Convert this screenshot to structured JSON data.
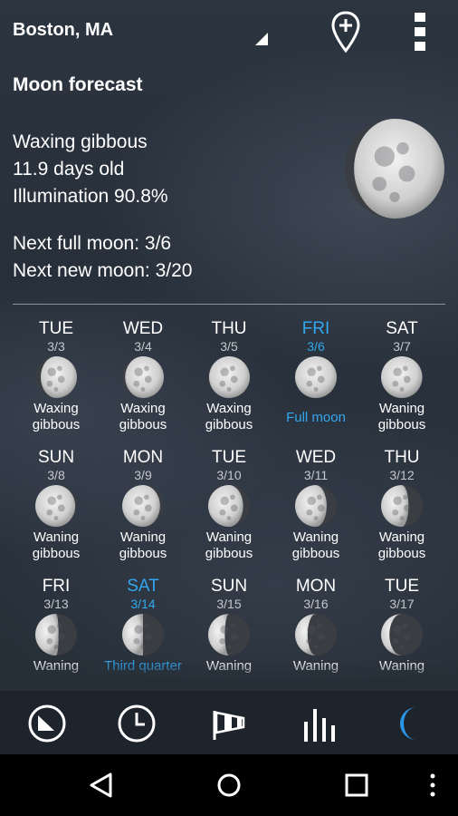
{
  "header": {
    "location": "Boston, MA",
    "icons": [
      "dropdown-icon",
      "add-location-pin-icon",
      "more-vert-icon"
    ]
  },
  "moon": {
    "title": "Moon forecast",
    "phase": "Waxing gibbous",
    "age": "11.9 days old",
    "illumination": "Illumination 90.8%",
    "next_full": "Next full moon: 3/6",
    "next_new": "Next new moon: 3/20",
    "illumination_fraction": 0.908
  },
  "days": [
    {
      "day": "TUE",
      "date": "3/3",
      "phase": "Waxing gibbous",
      "illum": 0.87,
      "waxing": true
    },
    {
      "day": "WED",
      "date": "3/4",
      "phase": "Waxing gibbous",
      "illum": 0.93,
      "waxing": true
    },
    {
      "day": "THU",
      "date": "3/5",
      "phase": "Waxing gibbous",
      "illum": 0.98,
      "waxing": true
    },
    {
      "day": "FRI",
      "date": "3/6",
      "phase": "Full moon",
      "illum": 1.0,
      "waxing": true,
      "highlight": true
    },
    {
      "day": "SAT",
      "date": "3/7",
      "phase": "Waning gibbous",
      "illum": 0.99,
      "waxing": false
    },
    {
      "day": "SUN",
      "date": "3/8",
      "phase": "Waning gibbous",
      "illum": 0.96,
      "waxing": false
    },
    {
      "day": "MON",
      "date": "3/9",
      "phase": "Waning gibbous",
      "illum": 0.91,
      "waxing": false
    },
    {
      "day": "TUE",
      "date": "3/10",
      "phase": "Waning gibbous",
      "illum": 0.84,
      "waxing": false
    },
    {
      "day": "WED",
      "date": "3/11",
      "phase": "Waning gibbous",
      "illum": 0.76,
      "waxing": false
    },
    {
      "day": "THU",
      "date": "3/12",
      "phase": "Waning gibbous",
      "illum": 0.66,
      "waxing": false
    },
    {
      "day": "FRI",
      "date": "3/13",
      "phase": "Waning",
      "illum": 0.56,
      "waxing": false
    },
    {
      "day": "SAT",
      "date": "3/14",
      "phase": "Third quarter",
      "illum": 0.5,
      "waxing": false,
      "highlight": true
    },
    {
      "day": "SUN",
      "date": "3/15",
      "phase": "Waning",
      "illum": 0.4,
      "waxing": false
    },
    {
      "day": "MON",
      "date": "3/16",
      "phase": "Waning",
      "illum": 0.3,
      "waxing": false
    },
    {
      "day": "TUE",
      "date": "3/17",
      "phase": "Waning",
      "illum": 0.2,
      "waxing": false
    }
  ],
  "tabs": [
    "forecast-chart-icon",
    "clock-icon",
    "windsock-icon",
    "bar-chart-icon",
    "moon-icon"
  ],
  "active_tab": "moon-icon",
  "colors": {
    "accent": "#33a7f0",
    "background": "#28313b",
    "tabbar": "#1d242c"
  },
  "nav": [
    "back-icon",
    "home-icon",
    "recents-icon",
    "more-vert-icon"
  ]
}
